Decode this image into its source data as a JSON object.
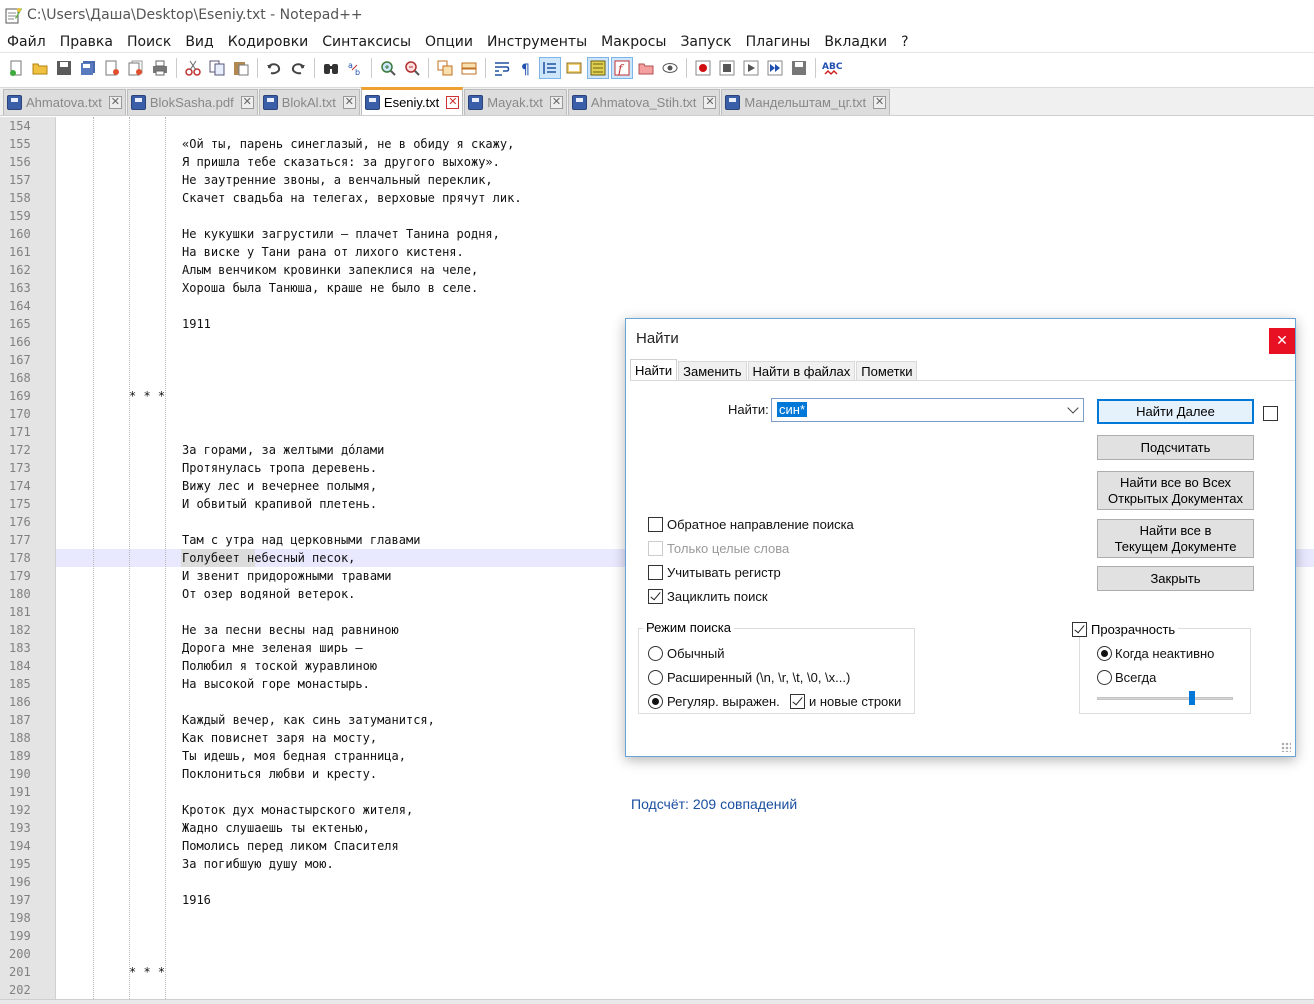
{
  "window": {
    "title": "C:\\Users\\Даша\\Desktop\\Eseniy.txt - Notepad++"
  },
  "menu": [
    "Файл",
    "Правка",
    "Поиск",
    "Вид",
    "Кодировки",
    "Синтаксисы",
    "Опции",
    "Инструменты",
    "Макросы",
    "Запуск",
    "Плагины",
    "Вкладки",
    "?"
  ],
  "tabs": [
    {
      "label": "Ahmatova.txt",
      "active": false
    },
    {
      "label": "BlokSasha.pdf",
      "active": false
    },
    {
      "label": "BlokAl.txt",
      "active": false
    },
    {
      "label": "Eseniy.txt",
      "active": true
    },
    {
      "label": "Mayak.txt",
      "active": false
    },
    {
      "label": "Ahmatova_Stih.txt",
      "active": false
    },
    {
      "label": "Мандельштам_цг.txt",
      "active": false
    }
  ],
  "tab_close_glyph": "✕",
  "editor": {
    "first_line": 154,
    "current_line": 178,
    "lines": [
      "",
      "«Ой ты, парень синеглазый, не в обиду я скажу,",
      "Я пришла тебе сказаться: за другого выхожу».",
      "Не заутренние звоны, а венчальный переклик,",
      "Скачет свадьба на телегах, верховые прячут лик.",
      "",
      "Не кукушки загрустили – плачет Танина родня,",
      "На виске у Тани рана от лихого кистеня.",
      "Алым венчиком кровинки запеклися на челе,",
      "Хороша была Танюша, краше не было в селе.",
      "",
      "1911",
      "",
      "",
      "",
      "* * *",
      "",
      "",
      "За горами, за желтыми дóлами",
      "Протянулась тропа деревень.",
      "Вижу лес и вечернее полымя,",
      "И обвитый крапивой плетень.",
      "",
      "Там с утра над церковными главами",
      "Голубеет небесный песок,",
      "И звенит придорожными травами",
      "От озер водяной ветерок.",
      "",
      "Не за песни весны над равниною",
      "Дорога мне зеленая ширь –",
      "Полюбил я тоской журавлиною",
      "На высокой горе монастырь.",
      "",
      "Каждый вечер, как синь затуманится,",
      "Как повиснет заря на мосту,",
      "Ты идешь, моя бедная странница,",
      "Поклониться любви и кресту.",
      "",
      "Кроток дух монастырского жителя,",
      "Жадно слушаешь ты ектенью,",
      "Помолись перед ликом Спасителя",
      "За погибшую душу мою.",
      "",
      "1916",
      "",
      "",
      "",
      "* * *",
      ""
    ]
  },
  "find_dialog": {
    "title": "Найти",
    "close_glyph": "✕",
    "tabs": [
      "Найти",
      "Заменить",
      "Найти в файлах",
      "Пометки"
    ],
    "find_label": "Найти:",
    "find_value": "син*",
    "buttons": {
      "find_next": "Найти Далее",
      "count": "Подсчитать",
      "find_all_open_1": "Найти все во Всех",
      "find_all_open_2": "Открытых Документах",
      "find_all_current_1": "Найти все в",
      "find_all_current_2": "Текущем Документе",
      "close": "Закрыть"
    },
    "options": {
      "backward": {
        "label": "Обратное направление поиска",
        "checked": false
      },
      "whole_word": {
        "label": "Только целые слова",
        "checked": false,
        "disabled": true
      },
      "match_case": {
        "label": "Учитывать регистр",
        "checked": false
      },
      "wrap": {
        "label": "Зациклить поиск",
        "checked": true
      }
    },
    "search_mode": {
      "title": "Режим поиска",
      "normal": "Обычный",
      "extended": "Расширенный (\\n, \\r, \\t, \\0, \\x...)",
      "regex": "Регуляр. выражен.",
      "newline": "и новые строки",
      "selected": "regex",
      "newline_checked": true
    },
    "transparency": {
      "title": "Прозрачность",
      "checked": true,
      "on_lose_focus": "Когда неактивно",
      "always": "Всегда",
      "selected": "on_lose_focus",
      "level": 0.7
    },
    "status": "Подсчёт: 209 совпадений"
  }
}
